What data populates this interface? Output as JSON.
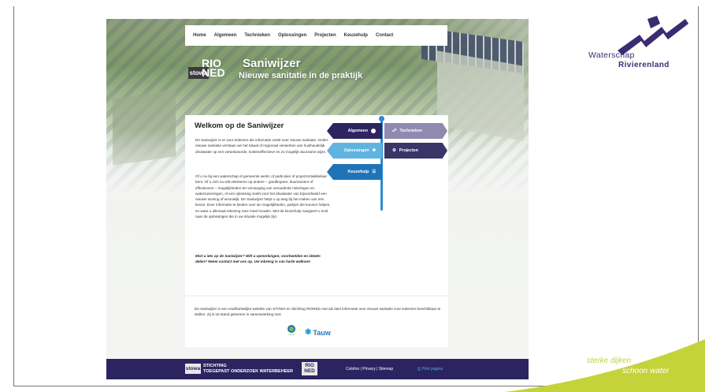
{
  "site": {
    "nav": [
      "Home",
      "Algemeen",
      "Technieken",
      "Oplossingen",
      "Projecten",
      "Keuzehulp",
      "Contact"
    ],
    "hero": {
      "stowa": "stowa",
      "rioned_top": "RIO",
      "rioned_bottom": "NED",
      "title": "Saniwijzer",
      "subtitle": "Nieuwe sanitatie in de praktijk"
    },
    "welcome": {
      "title": "Welkom op de Saniwijzer",
      "p1": "De Saniwijzer is er voor iedereen die informatie zoekt over nieuwe sanitatie. Onder nieuwe sanitatie verstaan we het lokaal of regionaal verwerken van huishoudelijk afvalwater op een verantwoorde, kosteneffectieve en zo mogelijk duurzame wijze.",
      "p2": "Of u nu bij een waterschap of gemeente werkt, of particulier of projectontwikkelaar bent. Of u zich nu wilt oriënteren op andere – goedkopere, duurzamere of effectievere – mogelijkheden ter vervanging van verouderde rioleringen en waterzuiveringen, of een oplossing zoekt voor het afvalwater van bijvoorbeeld een nieuwe woning of woonwijk. De Saniwijzer helpt u op weg bij het maken van een keuze. Door informatie te bieden over de mogelijkheden, partijen die kunnen helpen, en waar u allemaal rekening mee moet houden. Met de keuzehulp navigeert u snel naar de oplossingen die in uw situatie mogelijk zijn.",
      "p3": "Mist u iets op de Saniwijzer? Wilt u opmerkingen, voorbeelden en ideeën delen? Neem contact met ons op. Uw inbreng is van harte welkom!"
    },
    "menu": {
      "algemeen": "Algemeen",
      "technieken": "Technieken",
      "oplossingen": "Oplossingen",
      "projecten": "Projecten",
      "keuzehulp": "Keuzehulp"
    },
    "about": {
      "text": "De Saniwijzer is een onafhankelijke website van STOWA en Stichting RIONED met als doel informatie over nieuwe sanitatie voor iedereen beschikbaar te stellen. Zij is tot stand gekomen in samenwerking met:",
      "partner1": "LEAF",
      "partner2": "Tauw"
    },
    "footer": {
      "stowa": "stowa",
      "stichting_line1": "STICHTING",
      "stichting_line2": "TOEGEPAST ONDERZOEK WATERBEHEER",
      "rioned_top": "RIO",
      "rioned_bottom": "NED",
      "links": "Colofon | Privacy | Sitemap",
      "print": "Print pagina"
    }
  },
  "brand": {
    "line1": "Waterschap",
    "line2": "Rivierenland",
    "slogan1": "sterke dijken",
    "slogan2": "schoon water",
    "purple": "#3b2b73",
    "lime": "#c4d33a"
  }
}
